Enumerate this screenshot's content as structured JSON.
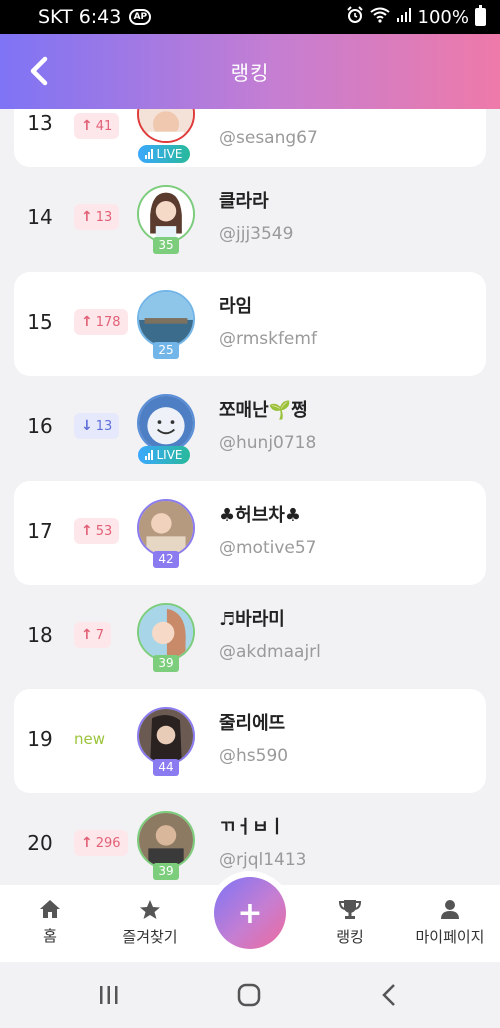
{
  "status_bar": {
    "carrier_time": "SKT 6:43",
    "badge": "AP",
    "battery": "100%"
  },
  "header": {
    "title": "랭킹",
    "back_icon": "chevron-left-icon"
  },
  "rows": [
    {
      "rank": "13",
      "change_dir": "up",
      "change_value": "41",
      "nickname": "",
      "user_id": "@sesang67",
      "live": "LIVE",
      "level": ""
    },
    {
      "rank": "14",
      "change_dir": "up",
      "change_value": "13",
      "nickname": "클라라",
      "user_id": "@jjj3549",
      "live": "",
      "level": "35"
    },
    {
      "rank": "15",
      "change_dir": "up",
      "change_value": "178",
      "nickname": "라임",
      "user_id": "@rmskfemf",
      "live": "",
      "level": "25"
    },
    {
      "rank": "16",
      "change_dir": "down",
      "change_value": "13",
      "nickname": "쪼매난🌱쩡",
      "user_id": "@hunj0718",
      "live": "LIVE",
      "level": ""
    },
    {
      "rank": "17",
      "change_dir": "up",
      "change_value": "53",
      "nickname": "♣허브차♣",
      "user_id": "@motive57",
      "live": "",
      "level": "42"
    },
    {
      "rank": "18",
      "change_dir": "up",
      "change_value": "7",
      "nickname": "♬바라미",
      "user_id": "@akdmaajrl",
      "live": "",
      "level": "39"
    },
    {
      "rank": "19",
      "change_dir": "new",
      "change_value": "new",
      "nickname": "줄리에뜨",
      "user_id": "@hs590",
      "live": "",
      "level": "44"
    },
    {
      "rank": "20",
      "change_dir": "up",
      "change_value": "296",
      "nickname": "ㄲㅓㅂㅣ",
      "user_id": "@rjql1413",
      "live": "",
      "level": "39"
    }
  ],
  "bottom_nav": {
    "home": "홈",
    "favorites": "즐겨찾기",
    "add": "+",
    "ranking": "랭킹",
    "mypage": "마이페이지"
  },
  "colors": {
    "header_start": "#7e74f5",
    "header_end": "#ee7aa9",
    "up": "#e26177",
    "down": "#5f6fd8",
    "new": "#9bc43a"
  }
}
